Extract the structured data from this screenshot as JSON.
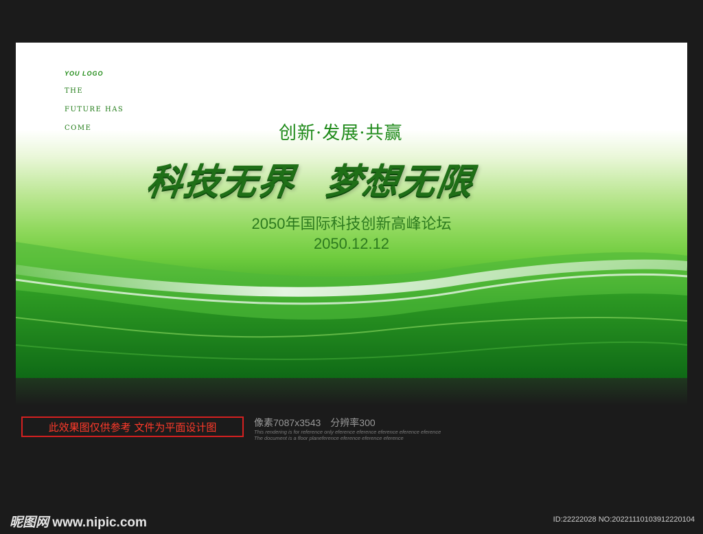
{
  "banner": {
    "logo": "YOU LOGO",
    "tagline_lines": [
      "THE",
      "FUTURE HAS",
      "COME"
    ],
    "slogan": "创新·发展·共赢",
    "headline_left": "科技无界",
    "headline_right": "梦想无限",
    "forum_title": "2050年国际科技创新高峰论坛",
    "date": "2050.12.12",
    "colors": {
      "primary_green": "#1f8a1a",
      "dark_green": "#17781a"
    }
  },
  "footer": {
    "notice": "此效果图仅供参考 文件为平面设计图",
    "pixels": "像素7087x3543",
    "resolution": "分辨率300",
    "fine_print_1": "This rendering is for reference only  eference eference eference eference eference",
    "fine_print_2": "The document is a floor planeference eference eference eference",
    "site_brand": "昵图网",
    "site_url": "www.nipic.com",
    "meta": "ID:22222028 NO:20221110103912220104"
  }
}
